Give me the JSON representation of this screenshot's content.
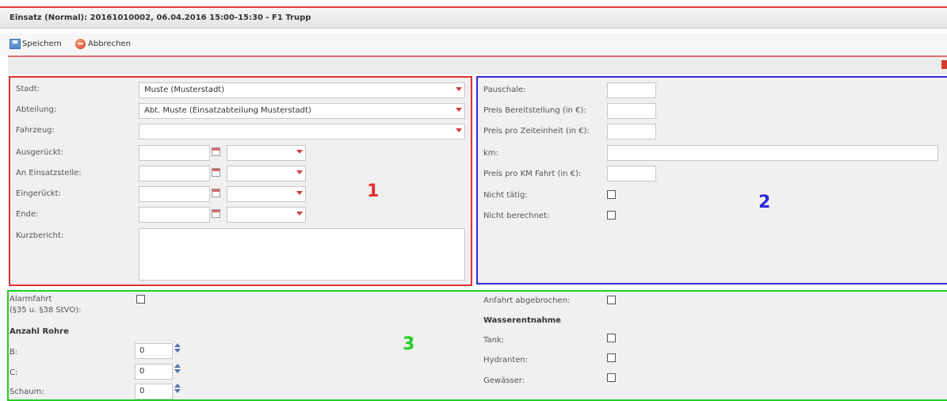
{
  "window": {
    "title": "Einsatz (Normal): 20161010002, 06.04.2016 15:00-15:30 - F1 Trupp"
  },
  "toolbar": {
    "save_label": "Speichern",
    "cancel_label": "Abbrechen"
  },
  "section1": {
    "number": "1",
    "color": "#e2302f",
    "stadt": {
      "label": "Stadt:",
      "value": "Muste (Musterstadt)"
    },
    "abteilung": {
      "label": "Abteilung:",
      "value": "Abt. Muste (Einsatzabteilung Musterstadt)"
    },
    "fahrzeug": {
      "label": "Fahrzeug:",
      "value": ""
    },
    "ausgerueckt": {
      "label": "Ausgerückt:"
    },
    "an_einsatzstelle": {
      "label": "An Einsatzstelle:"
    },
    "eingerueckt": {
      "label": "Eingerückt:"
    },
    "ende": {
      "label": "Ende:"
    },
    "kurzbericht": {
      "label": "Kurzbericht:",
      "value": ""
    }
  },
  "section2": {
    "number": "2",
    "color": "#2c2ce0",
    "pauschale": {
      "label": "Pauschale:",
      "value": ""
    },
    "preis_bereitstellung": {
      "label": "Preis Bereitstellung (in €):",
      "value": ""
    },
    "preis_zeiteinheit": {
      "label": "Preis pro Zeiteinheit (in €):",
      "value": ""
    },
    "km": {
      "label": "km:",
      "value": ""
    },
    "preis_km": {
      "label": "Preis pro KM Fahrt (in €):",
      "value": ""
    },
    "nicht_taetig": {
      "label": "Nicht tätig:",
      "checked": false
    },
    "nicht_berechnet": {
      "label": "Nicht berechnet:",
      "checked": false
    }
  },
  "section3": {
    "number": "3",
    "color": "#22d022",
    "alarmfahrt": {
      "label": "Alarmfahrt",
      "label2": "(§35 u. §38 StVO):",
      "checked": false
    },
    "anzahl_rohre_heading": "Anzahl Rohre",
    "rohre": [
      {
        "label": "B:",
        "value": "0"
      },
      {
        "label": "C:",
        "value": "0"
      },
      {
        "label": "Schaum:",
        "value": "0"
      }
    ],
    "anfahrt_abgebrochen": {
      "label": "Anfahrt abgebrochen:",
      "checked": false
    },
    "wasserentnahme_heading": "Wasserentnahme",
    "tank": {
      "label": "Tank:",
      "checked": false
    },
    "hydranten": {
      "label": "Hydranten:",
      "checked": false
    },
    "gewaesser": {
      "label": "Gewässer:",
      "checked": false
    }
  }
}
